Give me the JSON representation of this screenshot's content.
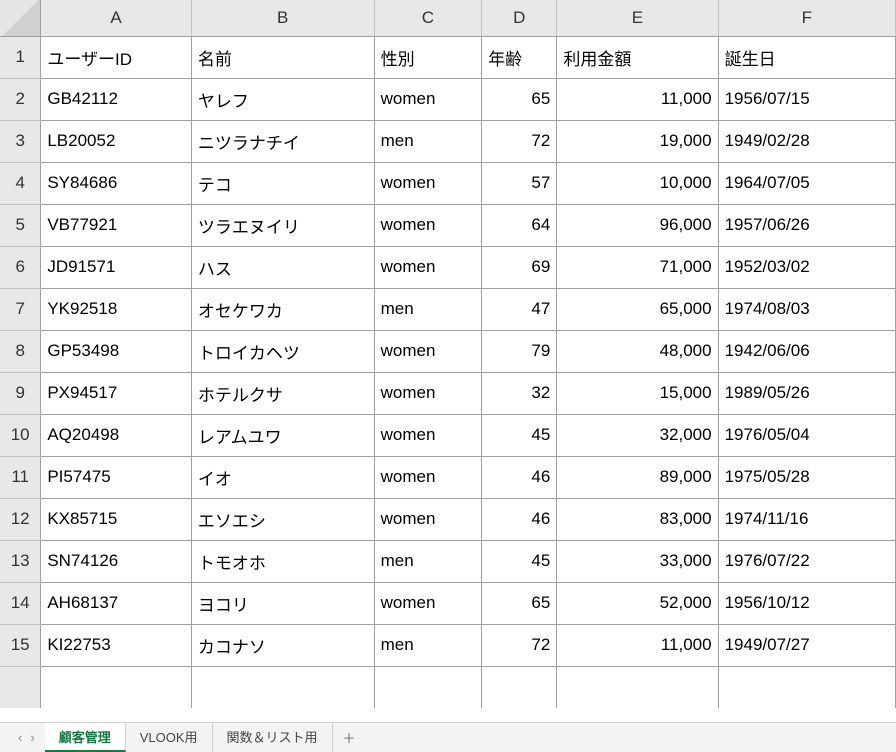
{
  "columns": [
    "A",
    "B",
    "C",
    "D",
    "E",
    "F"
  ],
  "headers": {
    "A": "ユーザーID",
    "B": "名前",
    "C": "性別",
    "D": "年齢",
    "E": "利用金額",
    "F": "誕生日"
  },
  "rows": [
    {
      "n": 2,
      "A": "GB42112",
      "B": "ヤレフ",
      "C": "women",
      "D": "65",
      "E": "11,000",
      "F": "1956/07/15"
    },
    {
      "n": 3,
      "A": "LB20052",
      "B": "ニツラナチイ",
      "C": "men",
      "D": "72",
      "E": "19,000",
      "F": "1949/02/28"
    },
    {
      "n": 4,
      "A": "SY84686",
      "B": "テコ",
      "C": "women",
      "D": "57",
      "E": "10,000",
      "F": "1964/07/05"
    },
    {
      "n": 5,
      "A": "VB77921",
      "B": "ツラエヌイリ",
      "C": "women",
      "D": "64",
      "E": "96,000",
      "F": "1957/06/26"
    },
    {
      "n": 6,
      "A": "JD91571",
      "B": "ハス",
      "C": "women",
      "D": "69",
      "E": "71,000",
      "F": "1952/03/02"
    },
    {
      "n": 7,
      "A": "YK92518",
      "B": "オセケワカ",
      "C": "men",
      "D": "47",
      "E": "65,000",
      "F": "1974/08/03"
    },
    {
      "n": 8,
      "A": "GP53498",
      "B": "トロイカヘツ",
      "C": "women",
      "D": "79",
      "E": "48,000",
      "F": "1942/06/06"
    },
    {
      "n": 9,
      "A": "PX94517",
      "B": "ホテルクサ",
      "C": "women",
      "D": "32",
      "E": "15,000",
      "F": "1989/05/26"
    },
    {
      "n": 10,
      "A": "AQ20498",
      "B": "レアムユワ",
      "C": "women",
      "D": "45",
      "E": "32,000",
      "F": "1976/05/04"
    },
    {
      "n": 11,
      "A": "PI57475",
      "B": "イオ",
      "C": "women",
      "D": "46",
      "E": "89,000",
      "F": "1975/05/28"
    },
    {
      "n": 12,
      "A": "KX85715",
      "B": "エソエシ",
      "C": "women",
      "D": "46",
      "E": "83,000",
      "F": "1974/11/16"
    },
    {
      "n": 13,
      "A": "SN74126",
      "B": "トモオホ",
      "C": "men",
      "D": "45",
      "E": "33,000",
      "F": "1976/07/22"
    },
    {
      "n": 14,
      "A": "AH68137",
      "B": "ヨコリ",
      "C": "women",
      "D": "65",
      "E": "52,000",
      "F": "1956/10/12"
    },
    {
      "n": 15,
      "A": "KI22753",
      "B": "カコナソ",
      "C": "men",
      "D": "72",
      "E": "11,000",
      "F": "1949/07/27"
    }
  ],
  "tabs": {
    "items": [
      {
        "label": "顧客管理",
        "active": true
      },
      {
        "label": "VLOOK用",
        "active": false
      },
      {
        "label": "関数＆リスト用",
        "active": false
      }
    ],
    "add": "＋"
  },
  "nav": {
    "prev": "‹",
    "next": "›"
  }
}
